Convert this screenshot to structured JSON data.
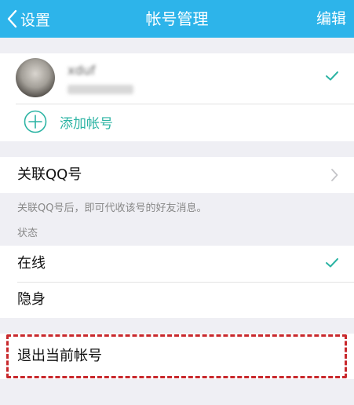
{
  "nav": {
    "back_label": "设置",
    "title": "帐号管理",
    "edit_label": "编辑"
  },
  "accounts": {
    "current_name": "xduf",
    "add_label": "添加帐号"
  },
  "link_qq": {
    "label": "关联QQ号",
    "hint": "关联QQ号后，即可代收该号的好友消息。"
  },
  "status": {
    "section_label": "状态",
    "options": [
      "在线",
      "隐身"
    ],
    "selected": "在线"
  },
  "logout": {
    "label": "退出当前帐号"
  },
  "colors": {
    "nav_bg": "#2db4ea",
    "accent": "#2db4a4",
    "highlight": "#c8282c"
  },
  "icons": {
    "back": "chevron-left-icon",
    "checkmark": "checkmark-icon",
    "add": "plus-circle-icon",
    "chevron": "chevron-right-icon"
  }
}
